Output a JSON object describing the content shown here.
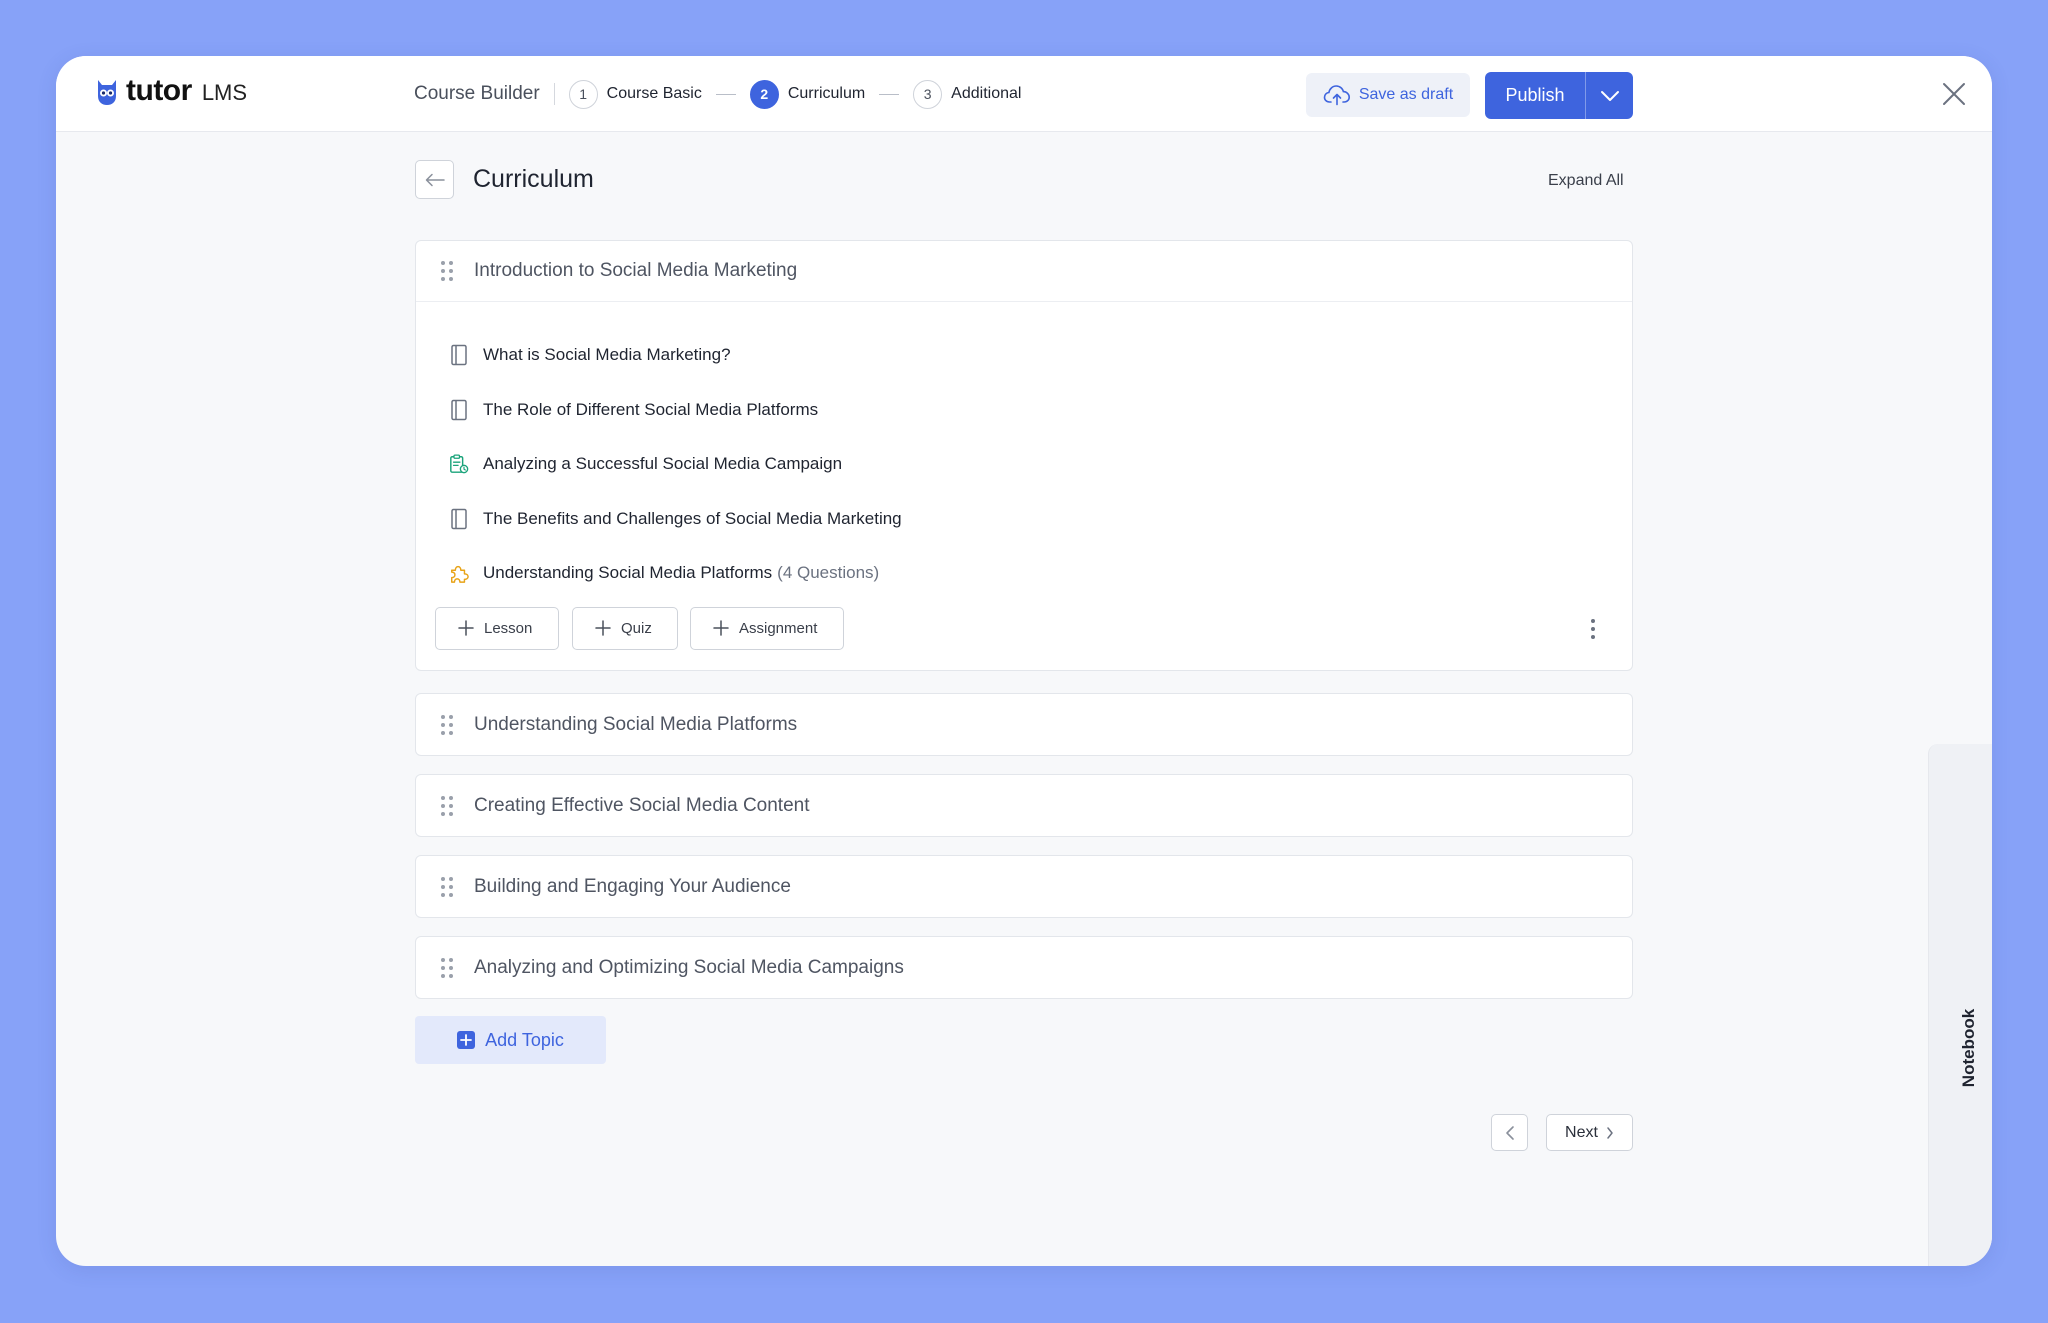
{
  "header": {
    "logo_word": "tutor",
    "logo_suffix": "LMS",
    "builder_label": "Course Builder",
    "steps": [
      {
        "num": "1",
        "label": "Course Basic",
        "active": false
      },
      {
        "num": "2",
        "label": "Curriculum",
        "active": true
      },
      {
        "num": "3",
        "label": "Additional",
        "active": false
      }
    ],
    "save_draft_label": "Save as draft",
    "publish_label": "Publish"
  },
  "page": {
    "title": "Curriculum",
    "expand_all_label": "Expand All"
  },
  "topics": [
    {
      "title": "Introduction to Social Media Marketing",
      "expanded": true,
      "items": [
        {
          "icon": "lesson-icon",
          "title": "What is Social Media Marketing?",
          "extra": ""
        },
        {
          "icon": "lesson-icon",
          "title": "The Role of Different Social Media Platforms",
          "extra": ""
        },
        {
          "icon": "assignment-icon",
          "title": "Analyzing a Successful Social Media Campaign",
          "extra": ""
        },
        {
          "icon": "lesson-icon",
          "title": "The Benefits and Challenges of Social Media Marketing",
          "extra": ""
        },
        {
          "icon": "quiz-icon",
          "title": "Understanding Social Media Platforms",
          "extra": "(4 Questions)"
        }
      ],
      "add_buttons": {
        "lesson": "Lesson",
        "quiz": "Quiz",
        "assignment": "Assignment"
      }
    },
    {
      "title": "Understanding Social Media Platforms",
      "expanded": false
    },
    {
      "title": "Creating Effective Social Media Content",
      "expanded": false
    },
    {
      "title": "Building and Engaging Your Audience",
      "expanded": false
    },
    {
      "title": "Analyzing and Optimizing Social Media Campaigns",
      "expanded": false
    }
  ],
  "add_topic_label": "Add Topic",
  "pagination": {
    "next_label": "Next"
  },
  "notebook_label": "Notebook",
  "colors": {
    "accent": "#3e64de",
    "background": "#87a2f8",
    "assignment_icon": "#1aa37a",
    "quiz_icon": "#e8a317"
  }
}
